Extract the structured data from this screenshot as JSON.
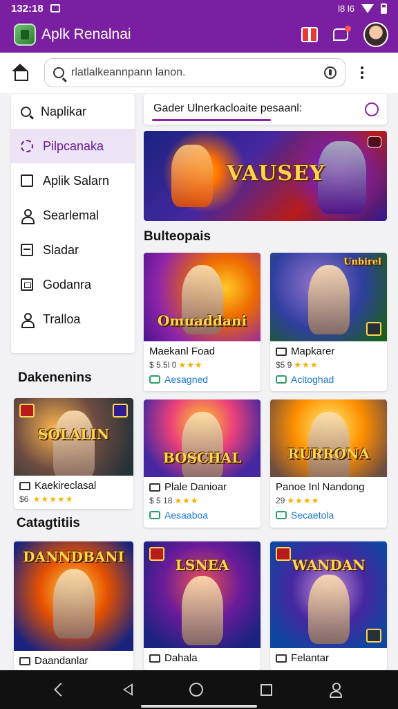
{
  "status_bar": {
    "time": "132:18",
    "right_text": "l8 l6"
  },
  "app_bar": {
    "title": "Aplk Renalnai"
  },
  "search": {
    "placeholder": "rlatlalkeannpann lanon."
  },
  "sidebar": {
    "items": [
      {
        "label": "Naplikar",
        "icon": "search-icon"
      },
      {
        "label": "Pilpcanaka",
        "icon": "gear-icon"
      },
      {
        "label": "Aplik Salarn",
        "icon": "square-icon"
      },
      {
        "label": "Searlemal",
        "icon": "person-icon"
      },
      {
        "label": "Sladar",
        "icon": "box-icon"
      },
      {
        "label": "Godanra",
        "icon": "calendar-icon"
      },
      {
        "label": "Tralloa",
        "icon": "person-icon"
      }
    ]
  },
  "notice": {
    "text": "Gader Ulnerkacloaite pesaanl:"
  },
  "banner": {
    "title": "VAUSEY"
  },
  "sections": {
    "s1": "Bulteopais",
    "s2": "Dakenenins",
    "s3": "Catagtitiis"
  },
  "cards": [
    {
      "art_title": "Omuaddani",
      "name": "Maekanl Foad",
      "meta": "$ 5.5l 0",
      "stars": "★★★",
      "status": "Aesagned"
    },
    {
      "art_title": "Unbirel",
      "name": "Mapkarer",
      "meta": "$5 9",
      "stars": "★★★",
      "status": "Acitoghad"
    },
    {
      "art_title": "SOLALIN",
      "name": "Kaekireclasal",
      "meta": "$6 ",
      "stars": "★★★★★",
      "status": ""
    },
    {
      "art_title": "BOSCHAL",
      "name": "Plale Danioar",
      "meta": "$ 5 18",
      "stars": "★★★",
      "status": "Aesaaboa"
    },
    {
      "art_title": "RURRONA",
      "name": "Panoe Inl Nandong",
      "meta": "29",
      "stars": "★★★★",
      "status": "Secaetola"
    },
    {
      "art_title": "DANNDBANI",
      "name": "Daandanlar",
      "meta": "",
      "stars": "",
      "status": ""
    },
    {
      "art_title": "LSNEA",
      "name": "Dahala",
      "meta": "",
      "stars": "",
      "status": ""
    },
    {
      "art_title": "WANDAN",
      "name": "Felantar",
      "meta": "",
      "stars": "",
      "status": ""
    }
  ]
}
